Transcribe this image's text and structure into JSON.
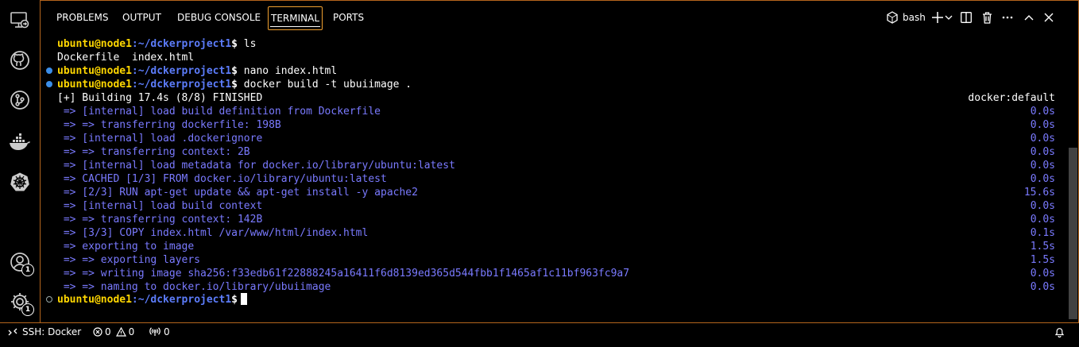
{
  "activity_bar": {
    "items": [
      {
        "name": "remote-explorer-icon"
      },
      {
        "name": "github-icon"
      },
      {
        "name": "source-control-icon"
      },
      {
        "name": "docker-icon"
      },
      {
        "name": "kubernetes-icon"
      }
    ],
    "accounts_badge": "1",
    "settings_badge": "1"
  },
  "panel": {
    "tabs": [
      "PROBLEMS",
      "OUTPUT",
      "DEBUG CONSOLE",
      "TERMINAL",
      "PORTS"
    ],
    "active_tab": "TERMINAL",
    "shell_label": "bash"
  },
  "terminal": {
    "prompt_user": "ubuntu@node1",
    "prompt_path": ":~/dckerproject1",
    "prompt_dollar": "$",
    "cmd1": " ls",
    "ls_output": "Dockerfile  index.html",
    "cmd2": " nano index.html",
    "cmd3": " docker build -t ubuiimage .",
    "build_header": "[+] Building 17.4s (8/8) FINISHED",
    "build_context": "docker:default",
    "steps": [
      {
        "text": " => [internal] load build definition from Dockerfile",
        "time": "0.0s"
      },
      {
        "text": " => => transferring dockerfile: 198B",
        "time": "0.0s"
      },
      {
        "text": " => [internal] load .dockerignore",
        "time": "0.0s"
      },
      {
        "text": " => => transferring context: 2B",
        "time": "0.0s"
      },
      {
        "text": " => [internal] load metadata for docker.io/library/ubuntu:latest",
        "time": "0.0s"
      },
      {
        "text": " => CACHED [1/3] FROM docker.io/library/ubuntu:latest",
        "time": "0.0s"
      },
      {
        "text": " => [2/3] RUN apt-get update && apt-get install -y apache2",
        "time": "15.6s"
      },
      {
        "text": " => [internal] load build context",
        "time": "0.0s"
      },
      {
        "text": " => => transferring context: 142B",
        "time": "0.0s"
      },
      {
        "text": " => [3/3] COPY index.html /var/www/html/index.html",
        "time": "0.1s"
      },
      {
        "text": " => exporting to image",
        "time": "1.5s"
      },
      {
        "text": " => => exporting layers",
        "time": "1.5s"
      },
      {
        "text": " => => writing image sha256:f33edb61f22888245a16411f6d8139ed365d544fbb1f1465af1c11bf963fc9a7",
        "time": "0.0s"
      },
      {
        "text": " => => naming to docker.io/library/ubuiimage",
        "time": "0.0s"
      }
    ]
  },
  "status_bar": {
    "remote": "SSH: Docker",
    "errors": "0",
    "warnings": "0",
    "ports": "0"
  },
  "colors": {
    "accent_border": "#b5651d",
    "prompt_user": "#ffd700",
    "prompt_path": "#5c7cfa",
    "build_step": "#7a7aff"
  }
}
